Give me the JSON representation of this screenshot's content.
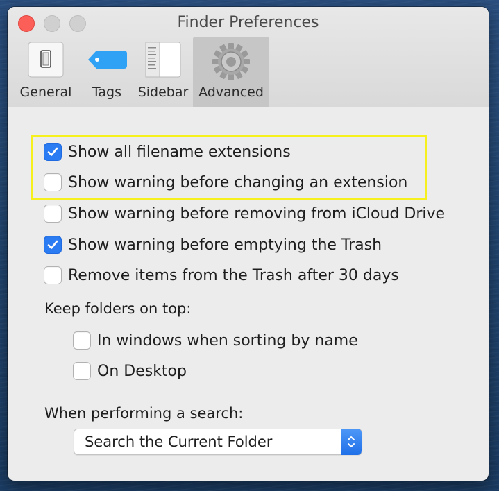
{
  "window": {
    "title": "Finder Preferences"
  },
  "tabs": [
    {
      "label": "General",
      "icon": "general-icon"
    },
    {
      "label": "Tags",
      "icon": "tag-icon"
    },
    {
      "label": "Sidebar",
      "icon": "sidebar-icon"
    },
    {
      "label": "Advanced",
      "icon": "gear-icon",
      "selected": true
    }
  ],
  "options": [
    {
      "label": "Show all filename extensions",
      "checked": true
    },
    {
      "label": "Show warning before changing an extension",
      "checked": false
    },
    {
      "label": "Show warning before removing from iCloud Drive",
      "checked": false
    },
    {
      "label": "Show warning before emptying the Trash",
      "checked": true
    },
    {
      "label": "Remove items from the Trash after 30 days",
      "checked": false
    }
  ],
  "keep_folders": {
    "heading": "Keep folders on top:",
    "options": [
      {
        "label": "In windows when sorting by name",
        "checked": false
      },
      {
        "label": "On Desktop",
        "checked": false
      }
    ]
  },
  "search": {
    "heading": "When performing a search:",
    "selected": "Search the Current Folder"
  },
  "colors": {
    "accent": "#2b7bf2",
    "highlight": "#f6f11e",
    "close": "#fc5f57"
  }
}
